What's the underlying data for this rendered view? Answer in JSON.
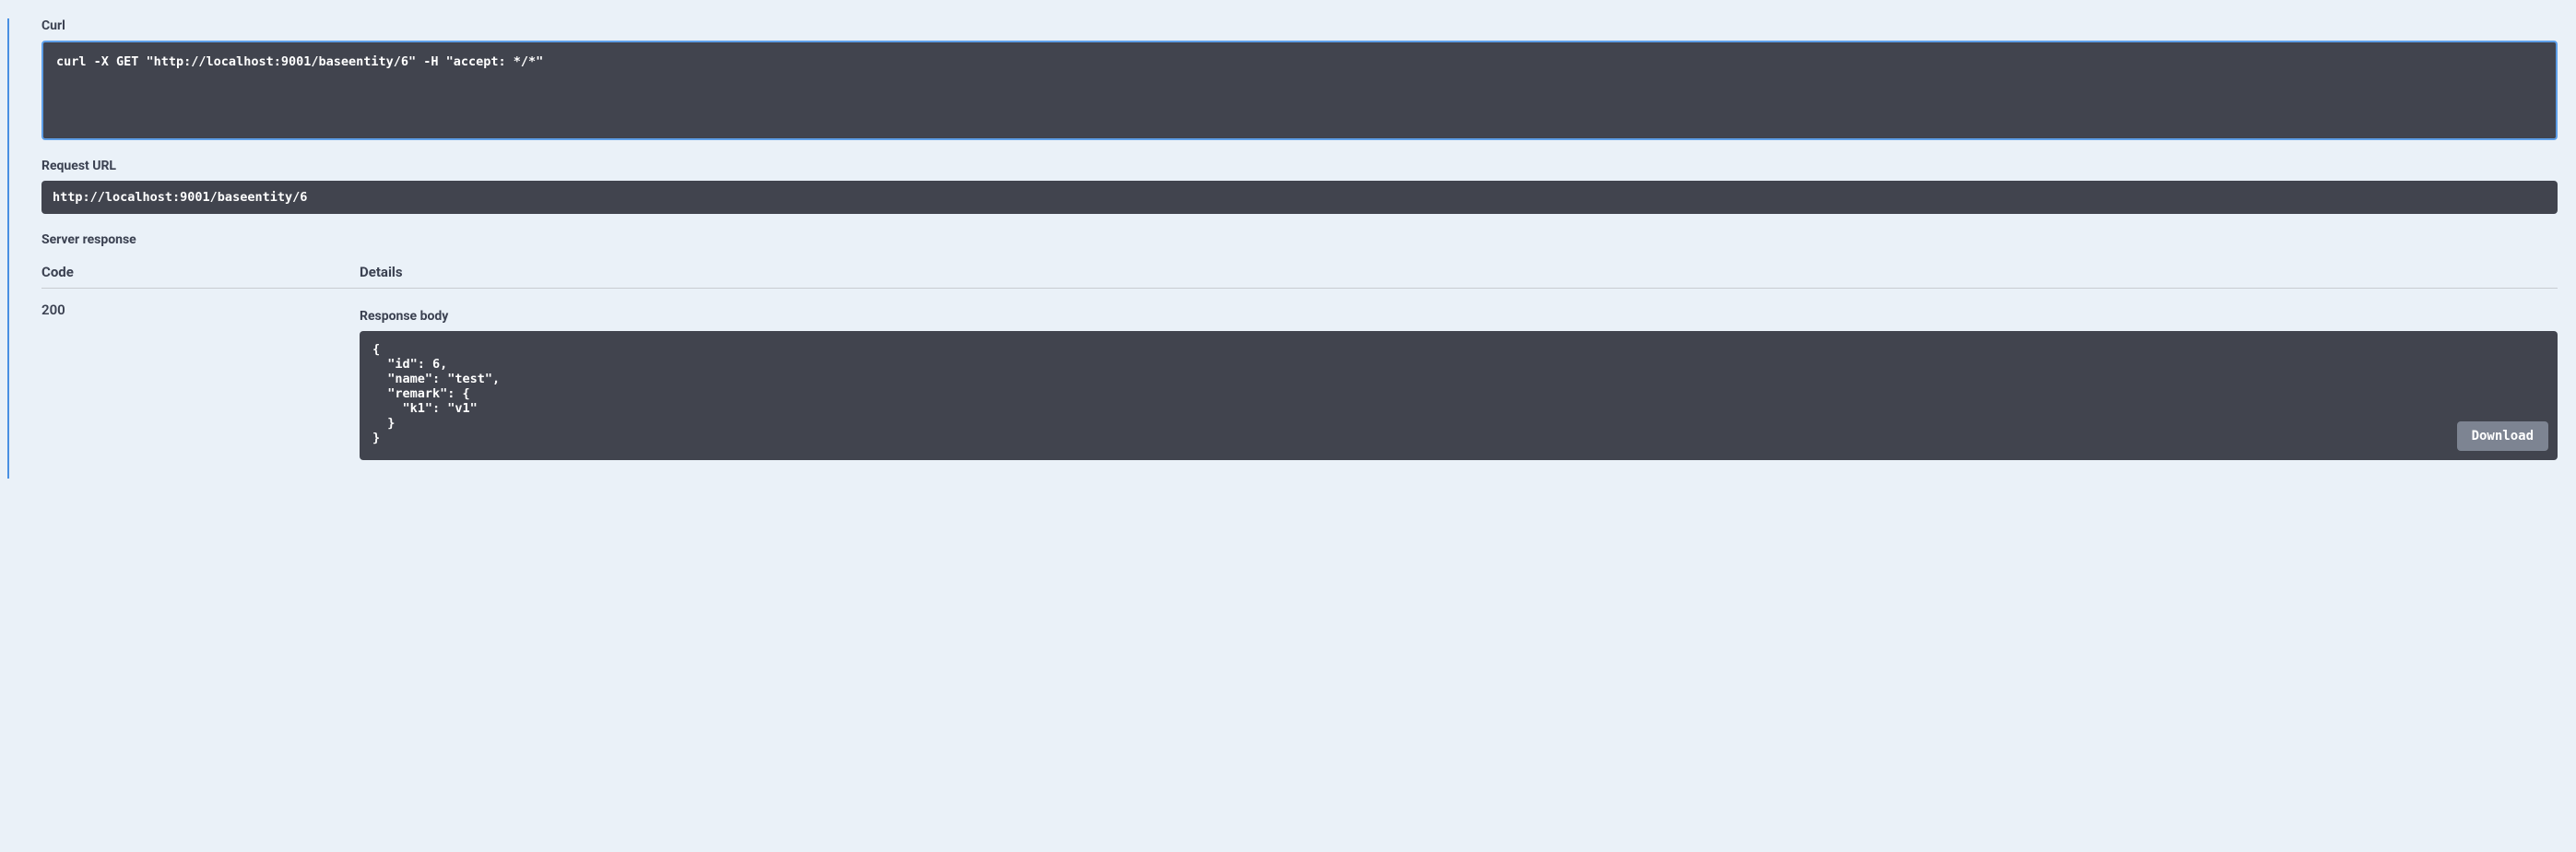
{
  "labels": {
    "curl": "Curl",
    "request_url": "Request URL",
    "server_response": "Server response",
    "code": "Code",
    "details": "Details",
    "response_body": "Response body",
    "download": "Download"
  },
  "curl_command": "curl -X GET \"http://localhost:9001/baseentity/6\" -H \"accept: */*\"",
  "request_url": "http://localhost:9001/baseentity/6",
  "response": {
    "code": "200",
    "body": "{\n  \"id\": 6,\n  \"name\": \"test\",\n  \"remark\": {\n    \"k1\": \"v1\"\n  }\n}"
  }
}
